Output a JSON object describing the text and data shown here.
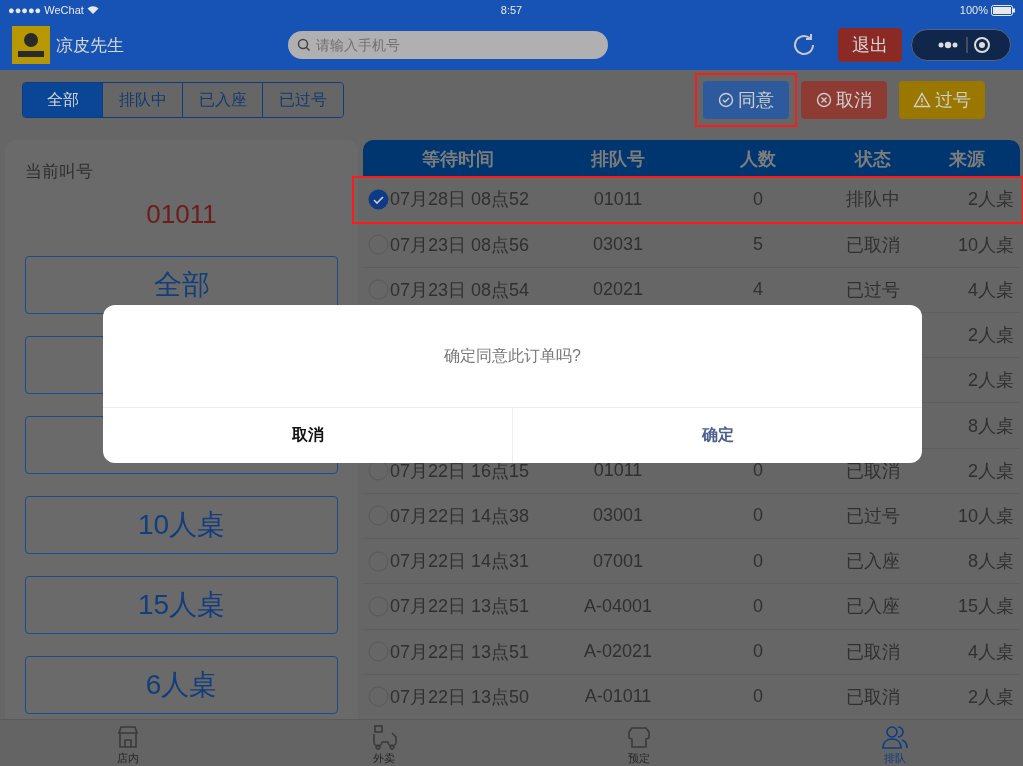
{
  "status_bar": {
    "carrier": "●●●●● WeChat",
    "time": "8:57",
    "battery": "100%"
  },
  "header": {
    "title": "凉皮先生",
    "search": {
      "placeholder": "请输入手机号"
    },
    "logout": "退出"
  },
  "filter_tabs": [
    {
      "label": "全部",
      "selected": true
    },
    {
      "label": "排队中",
      "selected": false
    },
    {
      "label": "已入座",
      "selected": false
    },
    {
      "label": "已过号",
      "selected": false
    }
  ],
  "actions": [
    {
      "kind": "approve",
      "label": "同意",
      "highlighted": true
    },
    {
      "kind": "cancel",
      "label": "取消",
      "highlighted": false
    },
    {
      "kind": "skip",
      "label": "过号",
      "highlighted": false
    }
  ],
  "current_call": {
    "label": "当前叫号",
    "number": "01011"
  },
  "table_buttons": [
    {
      "kind": "labeled",
      "label": "全部"
    },
    {
      "kind": "blank"
    },
    {
      "kind": "blank"
    },
    {
      "kind": "labeled",
      "label": "10人桌"
    },
    {
      "kind": "labeled",
      "label": "15人桌"
    },
    {
      "kind": "labeled",
      "label": "6人桌"
    }
  ],
  "table": {
    "columns": [
      "等待时间",
      "排队号",
      "人数",
      "状态",
      "来源"
    ],
    "rows": [
      {
        "selected": true,
        "highlighted": true,
        "wait_time": "07月28日 08点52",
        "number": "01011",
        "people": "0",
        "status": "排队中",
        "source": "2人桌"
      },
      {
        "selected": false,
        "highlighted": false,
        "wait_time": "07月23日 08点56",
        "number": "03031",
        "people": "5",
        "status": "已取消",
        "source": "10人桌"
      },
      {
        "selected": false,
        "highlighted": false,
        "wait_time": "07月23日 08点54",
        "number": "02021",
        "people": "4",
        "status": "已过号",
        "source": "4人桌"
      },
      {
        "source": "2人桌"
      },
      {
        "source": "2人桌"
      },
      {
        "source": "8人桌"
      },
      {
        "selected": false,
        "highlighted": false,
        "wait_time": "07月22日 16点15",
        "number": "01011",
        "people": "0",
        "status": "已取消",
        "source": "2人桌"
      },
      {
        "selected": false,
        "highlighted": false,
        "wait_time": "07月22日 14点38",
        "number": "03001",
        "people": "0",
        "status": "已过号",
        "source": "10人桌"
      },
      {
        "selected": false,
        "highlighted": false,
        "wait_time": "07月22日 14点31",
        "number": "07001",
        "people": "0",
        "status": "已入座",
        "source": "8人桌"
      },
      {
        "selected": false,
        "highlighted": false,
        "wait_time": "07月22日 13点51",
        "number": "A-04001",
        "people": "0",
        "status": "已入座",
        "source": "15人桌"
      },
      {
        "selected": false,
        "highlighted": false,
        "wait_time": "07月22日 13点51",
        "number": "A-02021",
        "people": "0",
        "status": "已取消",
        "source": "4人桌"
      },
      {
        "selected": false,
        "highlighted": false,
        "wait_time": "07月22日 13点50",
        "number": "A-01011",
        "people": "0",
        "status": "已取消",
        "source": "2人桌"
      }
    ]
  },
  "dialog": {
    "message": "确定同意此订单吗?",
    "cancel": "取消",
    "confirm": "确定"
  },
  "bottom_tabs": [
    {
      "kind": "store",
      "label": "店内",
      "selected": false
    },
    {
      "kind": "delivery",
      "label": "外卖",
      "selected": false
    },
    {
      "kind": "reserve",
      "label": "预定",
      "selected": false
    },
    {
      "kind": "queue",
      "label": "排队",
      "selected": true
    }
  ]
}
